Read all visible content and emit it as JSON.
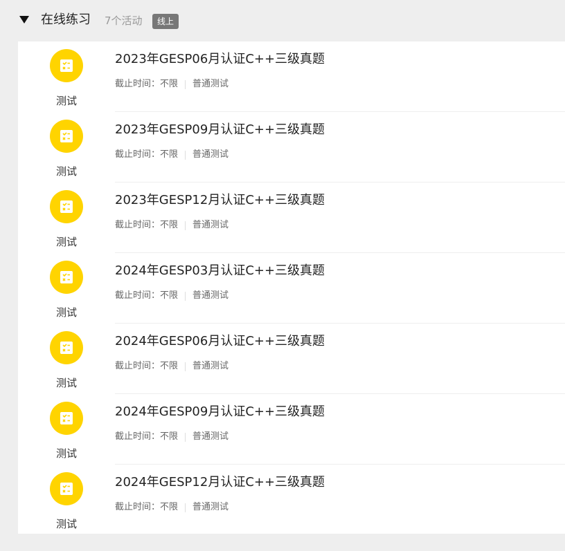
{
  "section": {
    "title": "在线练习",
    "count": "7个活动",
    "badge": "线上"
  },
  "meta_labels": {
    "deadline_label": "截止时间：",
    "deadline_value": "不限",
    "kind": "普通测试"
  },
  "items": [
    {
      "type": "测试",
      "title": "2023年GESP06月认证C++三级真题"
    },
    {
      "type": "测试",
      "title": "2023年GESP09月认证C++三级真题"
    },
    {
      "type": "测试",
      "title": "2023年GESP12月认证C++三级真题"
    },
    {
      "type": "测试",
      "title": "2024年GESP03月认证C++三级真题"
    },
    {
      "type": "测试",
      "title": "2024年GESP06月认证C++三级真题"
    },
    {
      "type": "测试",
      "title": "2024年GESP09月认证C++三级真题"
    },
    {
      "type": "测试",
      "title": "2024年GESP12月认证C++三级真题"
    }
  ],
  "colors": {
    "icon_bg": "#ffd400",
    "badge_bg": "#777777"
  },
  "icons": {
    "item": "test-paper-icon",
    "toggle": "caret-down-icon"
  }
}
